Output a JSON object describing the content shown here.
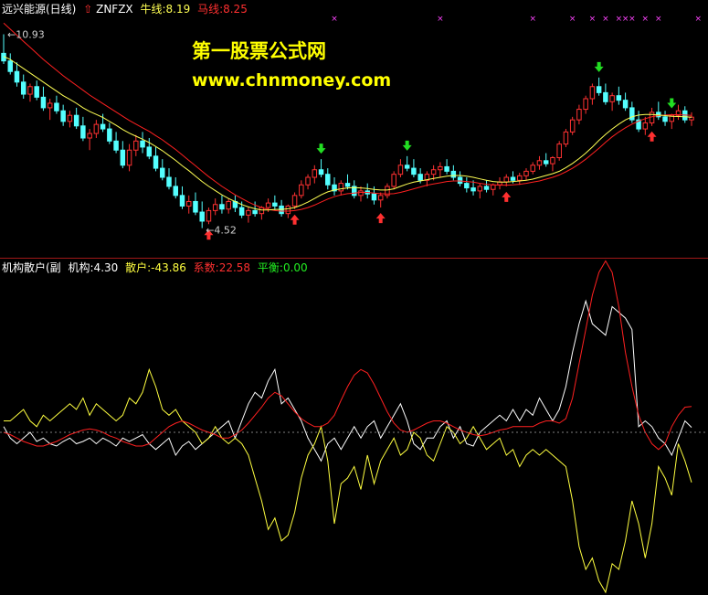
{
  "header": {
    "stock_name": "远兴能源(日线)",
    "formula": "ZNFZX",
    "ma1_label": "牛线:8.19",
    "ma2_label": "马线:8.25"
  },
  "watermark": {
    "line1": "第一股票公式网",
    "line2": "www.chnmoney.com"
  },
  "sub_header": {
    "name": "机构散户(副",
    "inst_label": "机构:4.30",
    "retail_label": "散户:-43.86",
    "coef_label": "系数:22.58",
    "balance_label": "平衡:0.00"
  },
  "colors": {
    "background": "#000000",
    "up_candle": "#ff3232",
    "down_candle": "#54ffff",
    "ma_fast": "#ffff54",
    "ma_slow": "#ff2020",
    "divider": "#a01818",
    "buy_arrow": "#ff3030",
    "sell_arrow": "#22dd22",
    "magenta_mark": "#ff44ff",
    "inst_line": "#ffffff",
    "retail_line": "#ffff40",
    "coef_line": "#ff2020",
    "balance_line": "#808080"
  },
  "chart_data": [
    {
      "type": "candlestick",
      "title": "远兴能源(日线)",
      "ylim": [
        3.6,
        11.4
      ],
      "annotations": [
        {
          "text": "10.93",
          "value": 10.93,
          "kind": "high"
        },
        {
          "text": "4.52",
          "value": 4.52,
          "kind": "low"
        }
      ],
      "ohlc": [
        [
          10.3,
          10.93,
          9.95,
          10.05
        ],
        [
          10.05,
          10.3,
          9.6,
          9.7
        ],
        [
          9.7,
          10.0,
          9.2,
          9.35
        ],
        [
          9.35,
          9.6,
          8.8,
          8.95
        ],
        [
          8.95,
          9.3,
          8.7,
          9.2
        ],
        [
          9.2,
          9.4,
          8.75,
          8.85
        ],
        [
          8.85,
          9.2,
          8.4,
          8.5
        ],
        [
          8.5,
          8.8,
          8.1,
          8.65
        ],
        [
          8.65,
          8.9,
          8.3,
          8.4
        ],
        [
          8.4,
          8.6,
          7.9,
          8.05
        ],
        [
          8.05,
          8.4,
          7.85,
          8.25
        ],
        [
          8.25,
          8.5,
          7.8,
          7.9
        ],
        [
          7.9,
          8.2,
          7.4,
          7.5
        ],
        [
          7.5,
          7.8,
          7.1,
          7.65
        ],
        [
          7.65,
          8.1,
          7.5,
          7.95
        ],
        [
          7.95,
          8.3,
          7.7,
          7.8
        ],
        [
          7.8,
          8.0,
          7.3,
          7.4
        ],
        [
          7.4,
          7.7,
          7.0,
          7.1
        ],
        [
          7.1,
          7.4,
          6.5,
          6.6
        ],
        [
          6.6,
          7.3,
          6.4,
          7.1
        ],
        [
          7.1,
          7.6,
          6.9,
          7.4
        ],
        [
          7.4,
          7.7,
          7.0,
          7.2
        ],
        [
          7.2,
          7.5,
          6.8,
          6.9
        ],
        [
          6.9,
          7.2,
          6.4,
          6.5
        ],
        [
          6.5,
          6.8,
          6.1,
          6.2
        ],
        [
          6.2,
          6.5,
          5.8,
          5.9
        ],
        [
          5.9,
          6.2,
          5.5,
          5.6
        ],
        [
          5.6,
          5.9,
          5.15,
          5.25
        ],
        [
          5.25,
          5.6,
          5.0,
          5.4
        ],
        [
          5.4,
          5.7,
          4.95,
          5.05
        ],
        [
          5.05,
          5.4,
          4.52,
          4.75
        ],
        [
          4.75,
          5.2,
          4.65,
          5.1
        ],
        [
          5.1,
          5.5,
          4.95,
          5.3
        ],
        [
          5.3,
          5.6,
          5.0,
          5.15
        ],
        [
          5.15,
          5.5,
          5.0,
          5.4
        ],
        [
          5.4,
          5.6,
          5.05,
          5.2
        ],
        [
          5.2,
          5.4,
          4.85,
          4.95
        ],
        [
          4.95,
          5.2,
          4.7,
          5.1
        ],
        [
          5.1,
          5.4,
          4.9,
          5.0
        ],
        [
          5.0,
          5.25,
          4.8,
          5.2
        ],
        [
          5.2,
          5.5,
          5.05,
          5.35
        ],
        [
          5.35,
          5.6,
          5.1,
          5.25
        ],
        [
          5.25,
          5.45,
          4.9,
          5.0
        ],
        [
          5.0,
          5.3,
          4.85,
          5.25
        ],
        [
          5.25,
          5.7,
          5.15,
          5.6
        ],
        [
          5.6,
          6.1,
          5.5,
          5.95
        ],
        [
          5.95,
          6.3,
          5.8,
          6.2
        ],
        [
          6.2,
          6.6,
          6.0,
          6.45
        ],
        [
          6.45,
          6.8,
          6.2,
          6.3
        ],
        [
          6.3,
          6.5,
          5.8,
          5.95
        ],
        [
          5.95,
          6.2,
          5.6,
          5.75
        ],
        [
          5.75,
          6.1,
          5.6,
          6.0
        ],
        [
          6.0,
          6.3,
          5.8,
          5.9
        ],
        [
          5.9,
          6.1,
          5.5,
          5.6
        ],
        [
          5.6,
          5.9,
          5.4,
          5.75
        ],
        [
          5.75,
          6.0,
          5.5,
          5.65
        ],
        [
          5.65,
          5.9,
          5.3,
          5.45
        ],
        [
          5.45,
          5.7,
          5.2,
          5.6
        ],
        [
          5.6,
          6.0,
          5.5,
          5.9
        ],
        [
          5.9,
          6.4,
          5.8,
          6.3
        ],
        [
          6.3,
          6.8,
          6.2,
          6.6
        ],
        [
          6.6,
          6.9,
          6.4,
          6.5
        ],
        [
          6.5,
          6.8,
          6.2,
          6.3
        ],
        [
          6.3,
          6.5,
          6.0,
          6.1
        ],
        [
          6.1,
          6.4,
          5.9,
          6.3
        ],
        [
          6.3,
          6.6,
          6.1,
          6.45
        ],
        [
          6.45,
          6.7,
          6.2,
          6.55
        ],
        [
          6.55,
          6.8,
          6.3,
          6.4
        ],
        [
          6.4,
          6.6,
          6.1,
          6.2
        ],
        [
          6.2,
          6.4,
          5.9,
          6.0
        ],
        [
          6.0,
          6.2,
          5.7,
          5.85
        ],
        [
          5.85,
          6.1,
          5.6,
          5.75
        ],
        [
          5.75,
          6.0,
          5.5,
          5.9
        ],
        [
          5.9,
          6.1,
          5.7,
          5.8
        ],
        [
          5.8,
          6.0,
          5.6,
          5.95
        ],
        [
          5.95,
          6.2,
          5.8,
          6.05
        ],
        [
          6.05,
          6.3,
          5.9,
          6.2
        ],
        [
          6.2,
          6.4,
          6.0,
          6.1
        ],
        [
          6.1,
          6.35,
          5.95,
          6.25
        ],
        [
          6.25,
          6.5,
          6.1,
          6.4
        ],
        [
          6.4,
          6.7,
          6.3,
          6.6
        ],
        [
          6.6,
          6.9,
          6.45,
          6.75
        ],
        [
          6.75,
          7.0,
          6.55,
          6.65
        ],
        [
          6.65,
          6.9,
          6.4,
          6.85
        ],
        [
          6.85,
          7.4,
          6.75,
          7.3
        ],
        [
          7.3,
          7.8,
          7.2,
          7.7
        ],
        [
          7.7,
          8.2,
          7.6,
          8.1
        ],
        [
          8.1,
          8.6,
          7.95,
          8.45
        ],
        [
          8.45,
          8.9,
          8.3,
          8.8
        ],
        [
          8.8,
          9.3,
          8.6,
          9.2
        ],
        [
          9.2,
          9.5,
          8.9,
          9.0
        ],
        [
          9.0,
          9.3,
          8.6,
          8.7
        ],
        [
          8.7,
          9.0,
          8.4,
          8.9
        ],
        [
          8.9,
          9.2,
          8.6,
          8.75
        ],
        [
          8.75,
          9.0,
          8.4,
          8.5
        ],
        [
          8.5,
          8.7,
          8.0,
          8.1
        ],
        [
          8.1,
          8.4,
          7.7,
          7.8
        ],
        [
          7.8,
          8.2,
          7.6,
          8.0
        ],
        [
          8.0,
          8.5,
          7.9,
          8.35
        ],
        [
          8.35,
          8.7,
          8.1,
          8.2
        ],
        [
          8.2,
          8.4,
          7.9,
          8.05
        ],
        [
          8.05,
          8.3,
          7.8,
          8.25
        ],
        [
          8.25,
          8.6,
          8.1,
          8.4
        ],
        [
          8.4,
          8.55,
          8.0,
          8.1
        ],
        [
          8.1,
          8.35,
          7.9,
          8.19
        ]
      ],
      "ma_fast": [
        10.2,
        10.1,
        9.95,
        9.8,
        9.65,
        9.5,
        9.35,
        9.2,
        9.05,
        8.9,
        8.78,
        8.65,
        8.5,
        8.38,
        8.28,
        8.18,
        8.05,
        7.92,
        7.78,
        7.66,
        7.56,
        7.46,
        7.35,
        7.22,
        7.08,
        6.92,
        6.76,
        6.58,
        6.42,
        6.24,
        6.06,
        5.9,
        5.76,
        5.62,
        5.5,
        5.4,
        5.3,
        5.22,
        5.16,
        5.12,
        5.12,
        5.14,
        5.14,
        5.16,
        5.2,
        5.28,
        5.38,
        5.5,
        5.62,
        5.72,
        5.78,
        5.82,
        5.85,
        5.86,
        5.85,
        5.83,
        5.8,
        5.78,
        5.78,
        5.82,
        5.9,
        5.98,
        6.04,
        6.08,
        6.12,
        6.16,
        6.2,
        6.24,
        6.26,
        6.26,
        6.24,
        6.2,
        6.15,
        6.1,
        6.06,
        6.04,
        6.04,
        6.06,
        6.08,
        6.1,
        6.14,
        6.2,
        6.26,
        6.32,
        6.4,
        6.52,
        6.66,
        6.82,
        7.0,
        7.2,
        7.42,
        7.62,
        7.8,
        7.96,
        8.1,
        8.2,
        8.26,
        8.28,
        8.28,
        8.26,
        8.24,
        8.22,
        8.21,
        8.2,
        8.19
      ],
      "ma_slow": [
        11.3,
        11.1,
        10.9,
        10.7,
        10.5,
        10.3,
        10.1,
        9.92,
        9.74,
        9.56,
        9.4,
        9.24,
        9.08,
        8.92,
        8.78,
        8.64,
        8.5,
        8.36,
        8.22,
        8.08,
        7.96,
        7.84,
        7.72,
        7.58,
        7.44,
        7.28,
        7.12,
        6.94,
        6.76,
        6.58,
        6.4,
        6.22,
        6.06,
        5.9,
        5.76,
        5.62,
        5.5,
        5.38,
        5.28,
        5.2,
        5.14,
        5.1,
        5.08,
        5.08,
        5.1,
        5.14,
        5.2,
        5.28,
        5.38,
        5.48,
        5.56,
        5.62,
        5.66,
        5.68,
        5.7,
        5.7,
        5.68,
        5.66,
        5.65,
        5.66,
        5.7,
        5.76,
        5.82,
        5.88,
        5.94,
        5.98,
        6.02,
        6.06,
        6.08,
        6.08,
        6.06,
        6.04,
        6.0,
        5.97,
        5.95,
        5.94,
        5.94,
        5.95,
        5.97,
        6.0,
        6.04,
        6.08,
        6.14,
        6.2,
        6.28,
        6.38,
        6.5,
        6.64,
        6.8,
        6.98,
        7.16,
        7.36,
        7.54,
        7.7,
        7.84,
        7.96,
        8.06,
        8.14,
        8.2,
        8.24,
        8.26,
        8.27,
        8.27,
        8.26,
        8.25
      ],
      "buy_signals": [
        31,
        44,
        57,
        76,
        98
      ],
      "sell_signals": [
        48,
        61,
        90,
        101
      ],
      "magenta_marks": [
        50,
        66,
        80,
        86,
        89,
        91,
        93,
        94,
        95,
        97,
        99,
        105
      ]
    },
    {
      "type": "line",
      "title": "机构散户(副",
      "ylim": [
        -140,
        140
      ],
      "series": [
        {
          "name": "机构",
          "values": [
            5,
            -5,
            -10,
            -5,
            0,
            -8,
            -5,
            -10,
            -12,
            -8,
            -5,
            -10,
            -8,
            -5,
            -10,
            -5,
            -8,
            -12,
            -5,
            -8,
            -5,
            -2,
            -10,
            -15,
            -10,
            -5,
            -20,
            -12,
            -8,
            -15,
            -10,
            -5,
            0,
            5,
            10,
            -5,
            10,
            25,
            35,
            30,
            45,
            55,
            25,
            30,
            20,
            10,
            -5,
            -15,
            -25,
            -10,
            -5,
            -15,
            -5,
            5,
            -5,
            5,
            10,
            -5,
            5,
            15,
            25,
            10,
            -10,
            -15,
            -5,
            -5,
            5,
            10,
            -5,
            5,
            -10,
            -12,
            0,
            5,
            10,
            15,
            10,
            20,
            10,
            20,
            15,
            30,
            20,
            10,
            20,
            40,
            70,
            95,
            115,
            95,
            90,
            85,
            110,
            105,
            100,
            90,
            5,
            10,
            5,
            -5,
            -10,
            -20,
            -5,
            10,
            4.3
          ]
        },
        {
          "name": "散户",
          "values": [
            10,
            10,
            15,
            20,
            10,
            5,
            15,
            10,
            15,
            20,
            25,
            20,
            30,
            15,
            25,
            20,
            15,
            10,
            15,
            30,
            25,
            35,
            55,
            40,
            20,
            15,
            20,
            10,
            5,
            0,
            -10,
            -5,
            5,
            -5,
            -10,
            -5,
            -10,
            -20,
            -40,
            -60,
            -85,
            -75,
            -95,
            -90,
            -70,
            -40,
            -20,
            -10,
            5,
            -25,
            -80,
            -45,
            -40,
            -30,
            -50,
            -20,
            -45,
            -25,
            -15,
            -5,
            -20,
            -15,
            0,
            -5,
            -20,
            -25,
            -10,
            5,
            0,
            -10,
            -5,
            5,
            -5,
            -15,
            -10,
            -5,
            -20,
            -15,
            -30,
            -20,
            -15,
            -20,
            -15,
            -20,
            -25,
            -30,
            -60,
            -100,
            -120,
            -110,
            -130,
            -140,
            -115,
            -120,
            -95,
            -60,
            -80,
            -110,
            -80,
            -30,
            -40,
            -55,
            -10,
            -25,
            -43.86
          ]
        },
        {
          "name": "系数",
          "values": [
            0,
            -2,
            -5,
            -8,
            -10,
            -12,
            -12,
            -10,
            -8,
            -5,
            -2,
            0,
            2,
            3,
            2,
            0,
            -3,
            -5,
            -8,
            -10,
            -12,
            -12,
            -10,
            -5,
            0,
            5,
            8,
            10,
            8,
            5,
            2,
            0,
            -2,
            -5,
            -5,
            -2,
            2,
            8,
            15,
            22,
            30,
            35,
            32,
            25,
            18,
            12,
            8,
            5,
            5,
            8,
            15,
            28,
            40,
            50,
            55,
            52,
            42,
            30,
            18,
            8,
            2,
            0,
            2,
            5,
            8,
            10,
            10,
            8,
            5,
            2,
            0,
            -2,
            -3,
            -2,
            0,
            2,
            3,
            5,
            5,
            5,
            5,
            8,
            10,
            10,
            8,
            12,
            30,
            60,
            90,
            120,
            140,
            150,
            140,
            110,
            70,
            40,
            15,
            0,
            -10,
            -15,
            -10,
            5,
            15,
            22,
            22.58
          ]
        },
        {
          "name": "平衡",
          "values": [
            0,
            0
          ]
        }
      ]
    }
  ]
}
